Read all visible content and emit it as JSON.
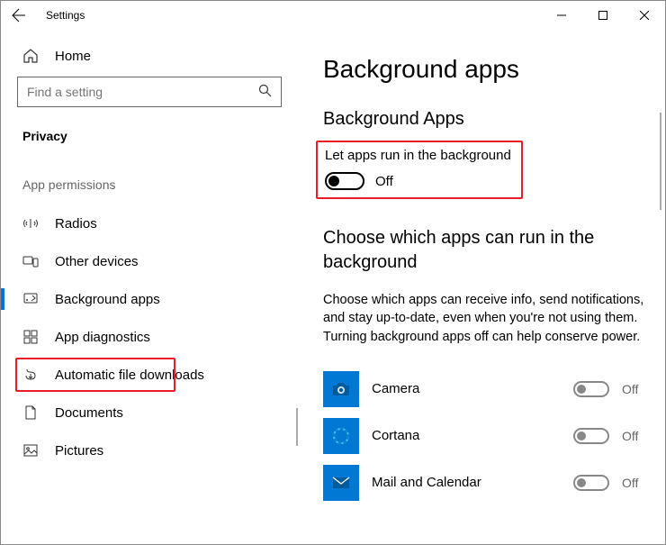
{
  "titlebar": {
    "app_title": "Settings"
  },
  "sidebar": {
    "home_label": "Home",
    "search_placeholder": "Find a setting",
    "section_heading": "Privacy",
    "section_subheading": "App permissions",
    "items": [
      {
        "label": "Radios"
      },
      {
        "label": "Other devices"
      },
      {
        "label": "Background apps",
        "active": true
      },
      {
        "label": "App diagnostics"
      },
      {
        "label": "Automatic file downloads"
      },
      {
        "label": "Documents"
      },
      {
        "label": "Pictures"
      }
    ]
  },
  "main": {
    "title": "Background apps",
    "subsection_title": "Background Apps",
    "master_toggle_label": "Let apps run in the background",
    "master_toggle_state": "Off",
    "choose_heading": "Choose which apps can run in the background",
    "description": "Choose which apps can receive info, send notifications, and stay up-to-date, even when you're not using them. Turning background apps off can help conserve power.",
    "apps": [
      {
        "name": "Camera",
        "state": "Off"
      },
      {
        "name": "Cortana",
        "state": "Off"
      },
      {
        "name": "Mail and Calendar",
        "state": "Off"
      }
    ]
  }
}
